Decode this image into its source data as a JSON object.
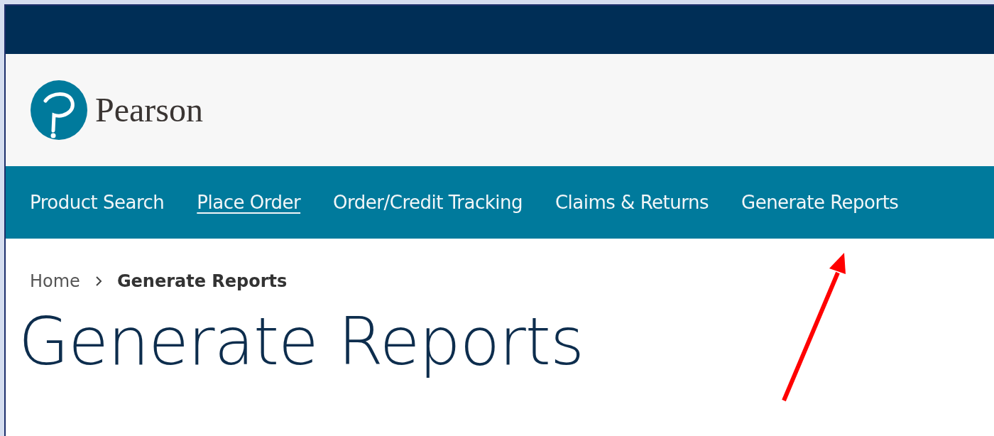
{
  "brand": {
    "name": "Pearson"
  },
  "nav": {
    "items": [
      {
        "label": "Product Search",
        "selected": false
      },
      {
        "label": "Place Order",
        "selected": true
      },
      {
        "label": "Order/Credit Tracking",
        "selected": false
      },
      {
        "label": "Claims & Returns",
        "selected": false
      },
      {
        "label": "Generate Reports",
        "selected": false
      }
    ]
  },
  "breadcrumb": {
    "items": [
      {
        "label": "Home",
        "current": false
      },
      {
        "label": "Generate Reports",
        "current": true
      }
    ]
  },
  "page_title": "Generate Reports"
}
